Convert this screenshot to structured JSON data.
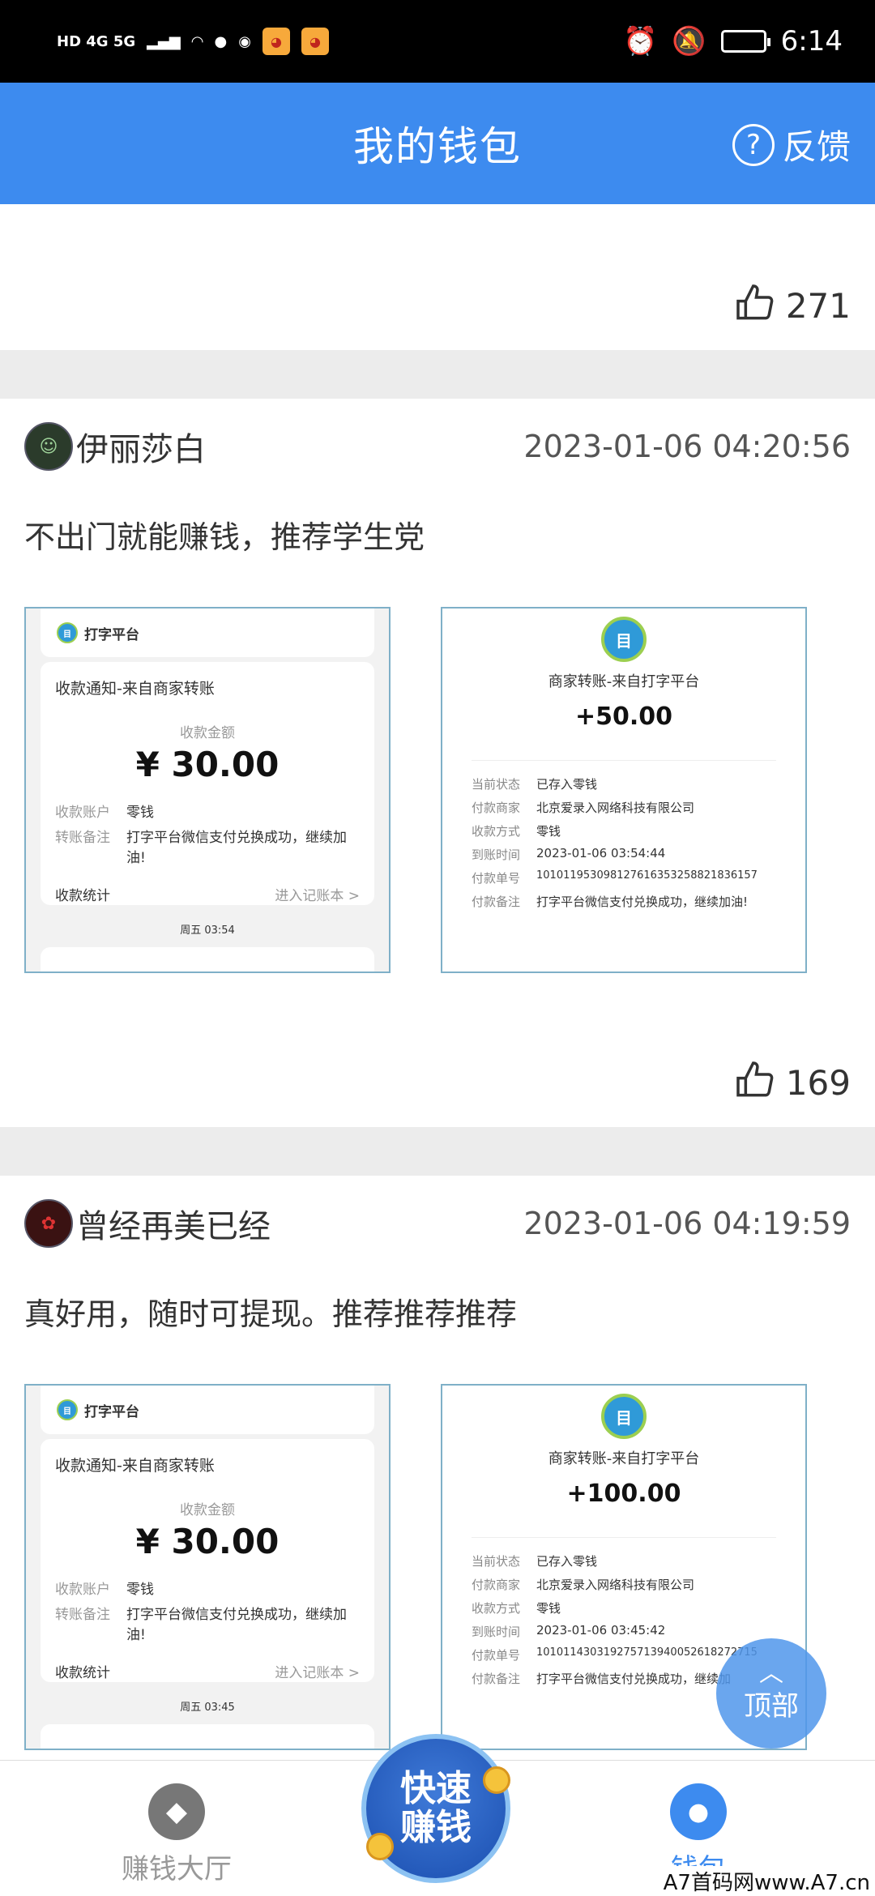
{
  "status_bar": {
    "network_left": "HD 4G 5G",
    "time": "6:14"
  },
  "header": {
    "title": "我的钱包",
    "feedback_label": "反馈",
    "help_icon": "?"
  },
  "first_like_count": "271",
  "posts": [
    {
      "username": "伊丽莎白",
      "timestamp": "2023-01-06 04:20:56",
      "text": "不出门就能赚钱，推荐学生党",
      "like_count": "169",
      "shot1": {
        "app_name": "打字平台",
        "notice": "收款通知-来自商家转账",
        "amount_label": "收款金额",
        "amount": "¥ 30.00",
        "account_label": "收款账户",
        "account_value": "零钱",
        "remark_label": "转账备注",
        "remark_value": "打字平台微信支付兑换成功，继续加油!",
        "stats_label": "收款统计",
        "ledger_link": "进入记账本 >",
        "time_label": "周五 03:54"
      },
      "shot2": {
        "title": "商家转账-来自打字平台",
        "amount": "+50.00",
        "rows": [
          {
            "k": "当前状态",
            "v": "已存入零钱"
          },
          {
            "k": "付款商家",
            "v": "北京爱录入网络科技有限公司"
          },
          {
            "k": "收款方式",
            "v": "零钱"
          },
          {
            "k": "到账时间",
            "v": "2023-01-06 03:54:44"
          },
          {
            "k": "付款单号",
            "v": "10101195309812761635325882183615​7"
          },
          {
            "k": "付款备注",
            "v": "打字平台微信支付兑换成功，继续加油!"
          }
        ]
      }
    },
    {
      "username": "曾经再美已经",
      "timestamp": "2023-01-06 04:19:59",
      "text": "真好用，随时可提现。推荐推荐推荐",
      "shot1": {
        "app_name": "打字平台",
        "notice": "收款通知-来自商家转账",
        "amount_label": "收款金额",
        "amount": "¥ 30.00",
        "account_label": "收款账户",
        "account_value": "零钱",
        "remark_label": "转账备注",
        "remark_value": "打字平台微信支付兑换成功，继续加油!",
        "stats_label": "收款统计",
        "ledger_link": "进入记账本 >",
        "time_label": "周五 03:45"
      },
      "shot2": {
        "title": "商家转账-来自打字平台",
        "amount": "+100.00",
        "rows": [
          {
            "k": "当前状态",
            "v": "已存入零钱"
          },
          {
            "k": "付款商家",
            "v": "北京爱录入网络科技有限公司"
          },
          {
            "k": "收款方式",
            "v": "零钱"
          },
          {
            "k": "到账时间",
            "v": "2023-01-06 03:45:42"
          },
          {
            "k": "付款单号",
            "v": "101011430319275713940052618272715"
          },
          {
            "k": "付款备注",
            "v": "打字平台微信支付兑换成功，继续加"
          }
        ]
      }
    }
  ],
  "bottom_nav": {
    "hall_label": "赚钱大厅",
    "fast_label_1": "快速",
    "fast_label_2": "赚钱",
    "wallet_label": "钱包"
  },
  "top_button_label": "顶部",
  "watermark": "A7首码网www.A7.cn",
  "colors": {
    "primary": "#3d8bef",
    "divider": "#ececec"
  }
}
